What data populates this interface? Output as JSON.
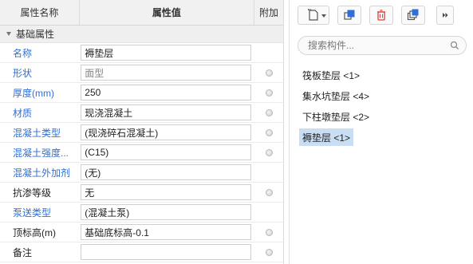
{
  "property_panel": {
    "headers": {
      "name": "属性名称",
      "value": "属性值",
      "add": "附加"
    },
    "group": {
      "label": "基础属性"
    },
    "rows": [
      {
        "name": "名称",
        "value": "褥垫层",
        "name_style": "link",
        "readonly": false,
        "has_add": false
      },
      {
        "name": "形状",
        "value": "面型",
        "name_style": "link",
        "readonly": true,
        "has_add": true
      },
      {
        "name": "厚度(mm)",
        "value": "250",
        "name_style": "link",
        "readonly": false,
        "has_add": true
      },
      {
        "name": "材质",
        "value": "现浇混凝土",
        "name_style": "link",
        "readonly": false,
        "has_add": true
      },
      {
        "name": "混凝土类型",
        "value": "(现浇碎石混凝土)",
        "name_style": "link",
        "readonly": false,
        "has_add": true
      },
      {
        "name": "混凝土强度...",
        "value": "(C15)",
        "name_style": "link",
        "readonly": false,
        "has_add": true
      },
      {
        "name": "混凝土外加剂",
        "value": "(无)",
        "name_style": "link",
        "readonly": false,
        "has_add": false
      },
      {
        "name": "抗渗等级",
        "value": "无",
        "name_style": "plain",
        "readonly": false,
        "has_add": true
      },
      {
        "name": "泵送类型",
        "value": "(混凝土泵)",
        "name_style": "link",
        "readonly": false,
        "has_add": false
      },
      {
        "name": "顶标高(m)",
        "value": "基础底标高-0.1",
        "name_style": "plain",
        "readonly": false,
        "has_add": true
      },
      {
        "name": "备注",
        "value": "",
        "name_style": "plain",
        "readonly": false,
        "has_add": true
      }
    ]
  },
  "component_panel": {
    "toolbar": {
      "new_icon": "new-component-icon",
      "copy_icon": "copy-icon",
      "delete_icon": "delete-icon",
      "layer_copy_icon": "layer-copy-icon",
      "more_icon": "double-chevron-right-icon"
    },
    "search": {
      "placeholder": "搜索构件..."
    },
    "items": [
      {
        "label": "筏板垫层 <1>",
        "selected": false
      },
      {
        "label": "集水坑垫层 <4>",
        "selected": false
      },
      {
        "label": "下柱墩垫层 <2>",
        "selected": false
      },
      {
        "label": "褥垫层 <1>",
        "selected": true
      }
    ]
  },
  "colors": {
    "link_text": "#2f6fd6",
    "selected_bg": "#c9ddf3",
    "header_bg": "#f1f1f1",
    "red_accent": "#e23b3b"
  }
}
